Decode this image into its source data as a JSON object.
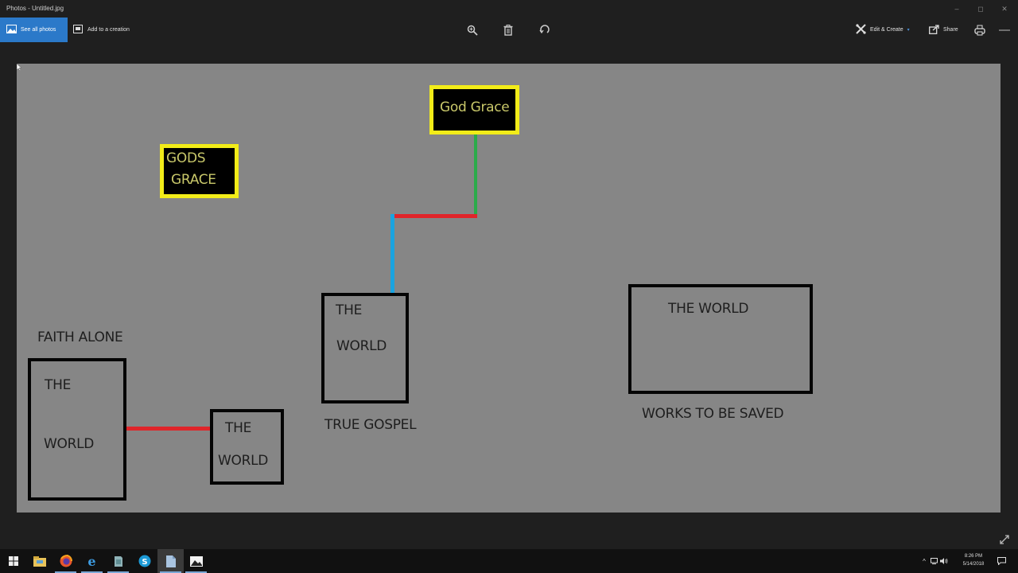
{
  "window": {
    "title": "Photos - Untitled.jpg",
    "controls": {
      "minimize": "–",
      "maximize": "◻",
      "close": "✕"
    }
  },
  "toolbar": {
    "see_all_photos": "See all photos",
    "add_to_creation": "Add to a creation",
    "center_icons": [
      "zoom-icon",
      "delete-icon",
      "rotate-icon"
    ],
    "edit_create": "Edit & Create",
    "share": "Share",
    "print_icon": "print-icon",
    "more_icon": "more-icon"
  },
  "diagram": {
    "gods_grace_box": {
      "line1": "GODS",
      "line2": "GRACE"
    },
    "god_grace_box": {
      "text": "God Grace"
    },
    "faith_alone": {
      "caption": "FAITH ALONE",
      "big_box": {
        "line1": "THE",
        "line2": "WORLD"
      },
      "small_box": {
        "line1": "THE",
        "line2": "WORLD"
      }
    },
    "true_gospel": {
      "caption": "TRUE GOSPEL",
      "box": {
        "line1": "THE",
        "line2": "WORLD"
      }
    },
    "works": {
      "caption": "WORKS TO BE SAVED",
      "box": {
        "text": "THE WORLD"
      }
    },
    "colors": {
      "background": "#868686",
      "yellow_border": "#f2ec19",
      "red_line": "#e0252a",
      "green_line": "#2bab4a",
      "blue_line": "#1aa3e0",
      "box_border": "#050505"
    }
  },
  "taskbar": {
    "apps": [
      "start-icon",
      "file-explorer-icon",
      "firefox-icon",
      "edge-icon",
      "app-icon",
      "skype-icon",
      "document-icon",
      "photos-icon"
    ],
    "clock_time": "8:26 PM",
    "clock_date": "5/14/2018"
  }
}
